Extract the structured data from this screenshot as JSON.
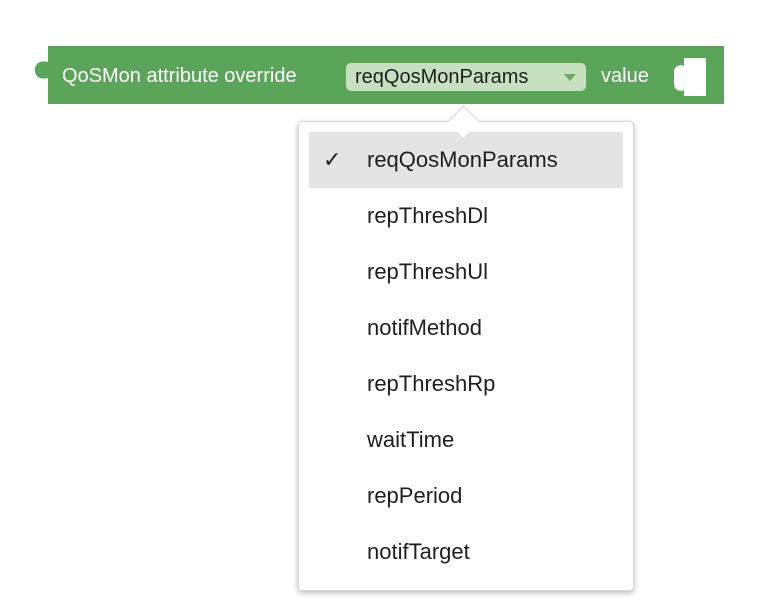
{
  "block": {
    "title": "QoSMon attribute override",
    "field_value": "reqQosMonParams",
    "value_label": "value",
    "color": "#5ba55a"
  },
  "menu": {
    "check_mark": "✓",
    "items": [
      {
        "label": "reqQosMonParams",
        "selected": true
      },
      {
        "label": "repThreshDl",
        "selected": false
      },
      {
        "label": "repThreshUl",
        "selected": false
      },
      {
        "label": "notifMethod",
        "selected": false
      },
      {
        "label": "repThreshRp",
        "selected": false
      },
      {
        "label": "waitTime",
        "selected": false
      },
      {
        "label": "repPeriod",
        "selected": false
      },
      {
        "label": "notifTarget",
        "selected": false
      }
    ]
  }
}
